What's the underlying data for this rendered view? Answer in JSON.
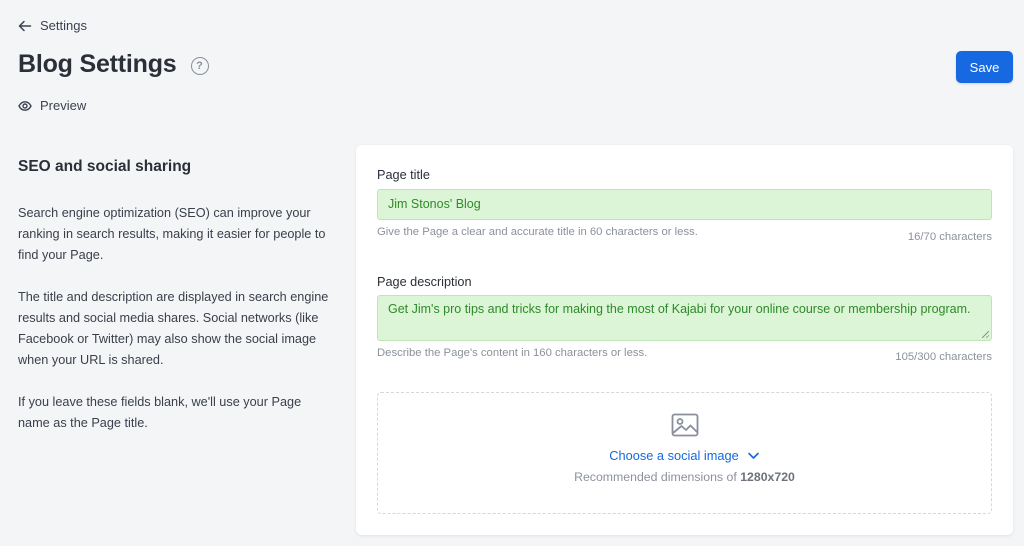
{
  "nav": {
    "back_label": "Settings"
  },
  "header": {
    "title": "Blog Settings",
    "help_glyph": "?",
    "preview_label": "Preview",
    "save_label": "Save"
  },
  "info": {
    "section_title": "SEO and social sharing",
    "paragraph_1": "Search engine optimization (SEO) can improve your ranking in search results, making it easier for people to find your Page.",
    "paragraph_2": "The title and description are displayed in search engine results and social media shares. Social networks (like Facebook or Twitter) may also show the social image when your URL is shared.",
    "paragraph_3": "If you leave these fields blank, we'll use your Page name as the Page title."
  },
  "form": {
    "page_title": {
      "label": "Page title",
      "value": "Jim Stonos' Blog",
      "hint": "Give the Page a clear and accurate title in 60 characters or less.",
      "counter": "16/70 characters"
    },
    "page_description": {
      "label": "Page description",
      "value": "Get Jim's pro tips and tricks for making the most of Kajabi for your online course or membership program.",
      "hint": "Describe the Page's content in 160 characters or less.",
      "counter": "105/300 characters"
    },
    "social_image": {
      "choose_label": "Choose a social image",
      "dims_prefix": "Recommended dimensions of",
      "dims_value": "1280x720"
    }
  },
  "colors": {
    "accent": "#1669e0",
    "filled_field_bg": "#dcf5d6",
    "filled_field_text": "#2e8a2a"
  },
  "icons": [
    "arrow-left-icon",
    "help-circle-icon",
    "eye-icon",
    "image-icon",
    "chevron-down-icon"
  ]
}
